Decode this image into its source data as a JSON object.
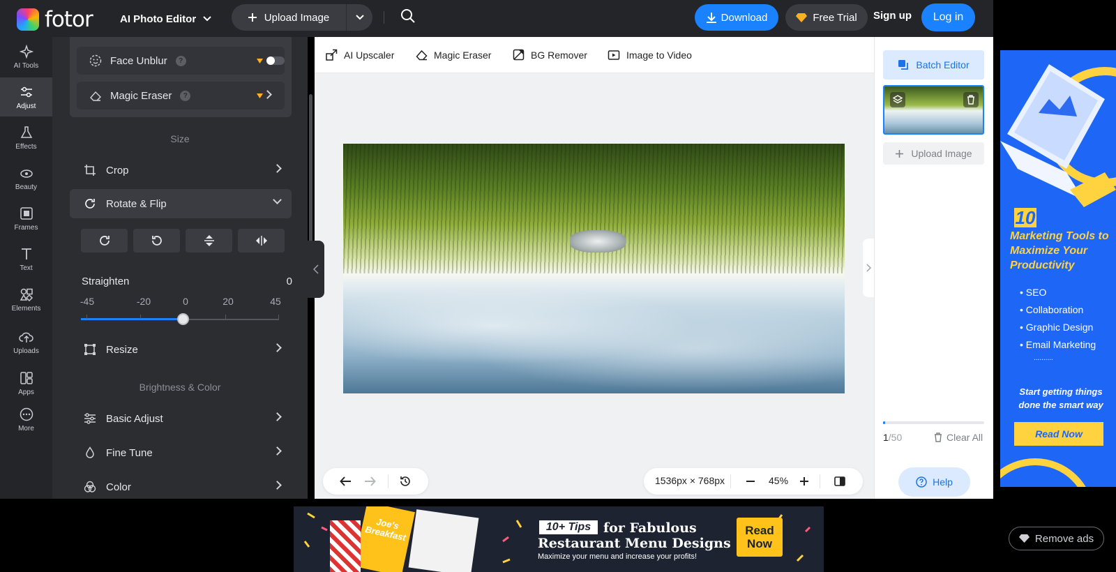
{
  "topbar": {
    "brand": "fotor",
    "editor_menu": "AI Photo Editor",
    "upload_label": "Upload Image",
    "download_label": "Download",
    "free_trial_label": "Free Trial",
    "signup_label": "Sign up",
    "login_label": "Log in"
  },
  "rail": [
    {
      "label": "AI Tools",
      "icon": "sparkle-icon"
    },
    {
      "label": "Adjust",
      "icon": "sliders-icon"
    },
    {
      "label": "Effects",
      "icon": "flask-icon"
    },
    {
      "label": "Beauty",
      "icon": "eye-icon"
    },
    {
      "label": "Frames",
      "icon": "frame-icon"
    },
    {
      "label": "Text",
      "icon": "text-icon"
    },
    {
      "label": "Elements",
      "icon": "shapes-icon"
    },
    {
      "label": "Uploads",
      "icon": "cloud-upload-icon"
    },
    {
      "label": "Apps",
      "icon": "apps-icon"
    },
    {
      "label": "More",
      "icon": "more-icon"
    }
  ],
  "panel": {
    "face_unblur": "Face Unblur",
    "magic_eraser": "Magic Eraser",
    "section_size": "Size",
    "crop": "Crop",
    "rotate_flip": "Rotate & Flip",
    "straighten": "Straighten",
    "straighten_value": "0",
    "straighten_ticks": [
      "-45",
      "-20",
      "0",
      "20",
      "45"
    ],
    "resize": "Resize",
    "section_brightness": "Brightness & Color",
    "basic_adjust": "Basic Adjust",
    "fine_tune": "Fine Tune",
    "color": "Color"
  },
  "toolbar": {
    "ai_upscaler": "AI Upscaler",
    "magic_eraser": "Magic Eraser",
    "bg_remover": "BG Remover",
    "image_to_video": "Image to Video"
  },
  "canvas": {
    "dimensions": "1536px × 768px",
    "zoom": "45%"
  },
  "right_panel": {
    "batch_editor": "Batch Editor",
    "upload_image": "Upload Image",
    "count_current": "1",
    "count_total": "/50",
    "clear_all": "Clear All",
    "help": "Help"
  },
  "ad_side": {
    "number": "10",
    "headline": "Marketing Tools to Maximize Your Productivity",
    "bullets": [
      "SEO",
      "Collaboration",
      "Graphic Design",
      "Email Marketing"
    ],
    "dots": "..........",
    "tagline": "Start getting things done the smart way",
    "cta": "Read Now"
  },
  "ad_bottom": {
    "menu_title": "Joe's Breakfast",
    "badge": "10+ Tips",
    "headline_a": "for Fabulous",
    "headline_b": "Restaurant Menu Designs",
    "subline": "Maximize your menu and increase your profits!",
    "cta_line1": "Read",
    "cta_line2": "Now"
  },
  "remove_ads": "Remove ads",
  "colors": {
    "accent": "#1a82ff",
    "panel_bg": "#2b2d31",
    "ad_yellow": "#ffd23f"
  }
}
